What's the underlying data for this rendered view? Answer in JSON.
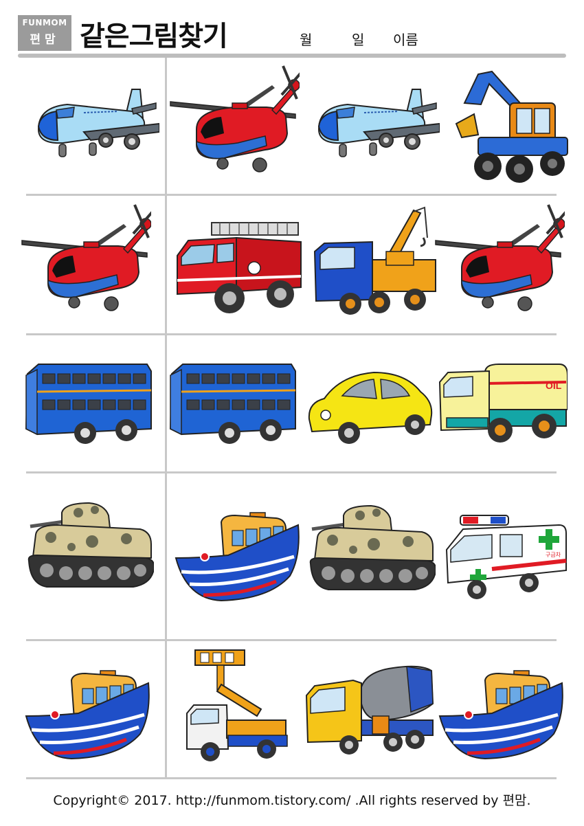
{
  "header": {
    "logo_top": "FUNMOM",
    "logo_bottom": "편맘",
    "title": "같은그림찾기",
    "month_label": "월",
    "day_label": "일",
    "name_label": "이름"
  },
  "rows": [
    {
      "items": [
        {
          "name": "airplane"
        },
        {
          "name": "helicopter"
        },
        {
          "name": "airplane"
        },
        {
          "name": "excavator"
        }
      ]
    },
    {
      "items": [
        {
          "name": "helicopter"
        },
        {
          "name": "fire-truck"
        },
        {
          "name": "tow-truck"
        },
        {
          "name": "helicopter"
        }
      ]
    },
    {
      "items": [
        {
          "name": "double-decker-bus"
        },
        {
          "name": "double-decker-bus"
        },
        {
          "name": "yellow-car"
        },
        {
          "name": "oil-tanker-truck",
          "label": "OIL"
        }
      ]
    },
    {
      "items": [
        {
          "name": "tank"
        },
        {
          "name": "boat"
        },
        {
          "name": "tank"
        },
        {
          "name": "ambulance",
          "label": "구급차"
        }
      ]
    },
    {
      "items": [
        {
          "name": "boat"
        },
        {
          "name": "aerial-lift-truck"
        },
        {
          "name": "cement-mixer-truck"
        },
        {
          "name": "boat"
        }
      ]
    }
  ],
  "footer": "Copyright© 2017. http://funmom.tistory.com/ .All rights reserved by 편맘."
}
